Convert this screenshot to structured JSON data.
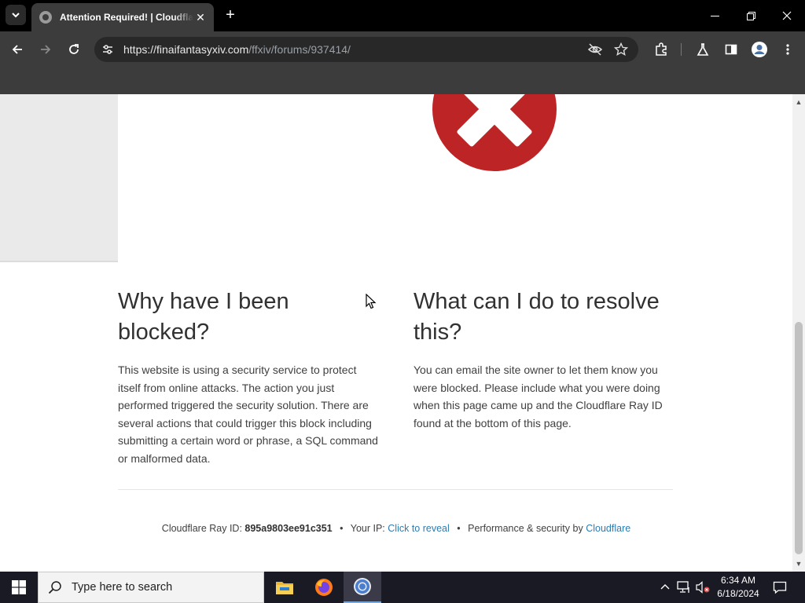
{
  "browser": {
    "tab_title": "Attention Required! | Cloudflare",
    "tab_close": "✕",
    "new_tab": "+",
    "url_host": "https://finaifantasyxiv.com",
    "url_path": "/ffxiv/forums/937414/"
  },
  "page": {
    "left": {
      "heading": "Why have I been blocked?",
      "body": "This website is using a security service to protect itself from online attacks. The action you just performed triggered the security solution. There are several actions that could trigger this block including submitting a certain word or phrase, a SQL command or malformed data."
    },
    "right": {
      "heading": "What can I do to resolve this?",
      "body": "You can email the site owner to let them know you were blocked. Please include what you were doing when this page came up and the Cloudflare Ray ID found at the bottom of this page."
    },
    "footer": {
      "ray_label": "Cloudflare Ray ID:",
      "ray_id": "895a9803ee91c351",
      "bullet": "•",
      "ip_label": "Your IP:",
      "ip_link": "Click to reveal",
      "perf_label": "Performance & security by",
      "perf_link": "Cloudflare"
    }
  },
  "taskbar": {
    "search_placeholder": "Type here to search",
    "time": "6:34 AM",
    "date": "6/18/2024"
  },
  "colors": {
    "error_red": "#bd2426",
    "link_blue": "#2c7cb0",
    "chrome_dark": "#3c3c3c"
  },
  "icons": [
    "tab-search-icon",
    "favicon-icon",
    "back-icon",
    "forward-icon",
    "reload-icon",
    "site-info-icon",
    "eye-off-icon",
    "star-icon",
    "extensions-icon",
    "labs-icon",
    "side-panel-icon",
    "profile-icon",
    "menu-icon",
    "error-x-icon",
    "windows-start-icon",
    "search-icon",
    "file-explorer-icon",
    "firefox-icon",
    "chrome-icon",
    "chevron-up-icon",
    "network-icon",
    "volume-muted-icon",
    "notifications-icon"
  ]
}
